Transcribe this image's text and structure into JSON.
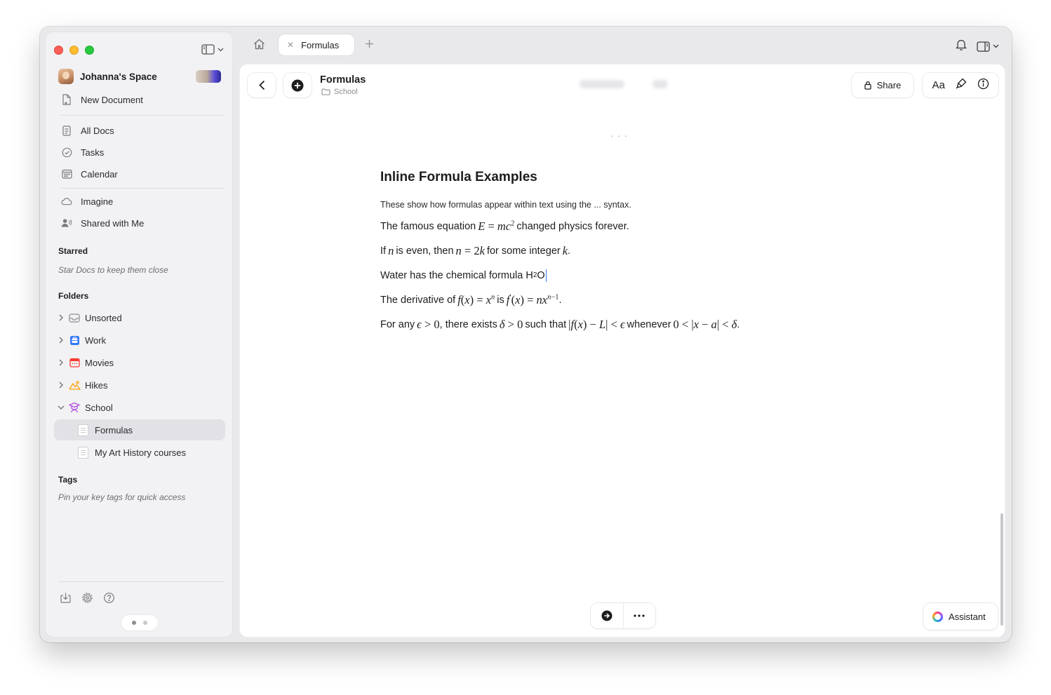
{
  "sidebar": {
    "space_name": "Johanna's Space",
    "new_document": "New Document",
    "nav": [
      {
        "label": "All Docs",
        "icon": "document-icon"
      },
      {
        "label": "Tasks",
        "icon": "checkmark-circle-icon"
      },
      {
        "label": "Calendar",
        "icon": "calendar-icon"
      },
      {
        "label": "Imagine",
        "icon": "cloud-icon"
      },
      {
        "label": "Shared with Me",
        "icon": "shared-person-icon"
      }
    ],
    "starred_title": "Starred",
    "starred_hint": "Star Docs to keep them close",
    "folders_title": "Folders",
    "folders": [
      {
        "label": "Unsorted",
        "icon": "inbox-icon",
        "color": "#8e8e93"
      },
      {
        "label": "Work",
        "icon": "briefcase-icon",
        "color": "#3478f6"
      },
      {
        "label": "Movies",
        "icon": "calendar-icon",
        "color": "#ff3b30"
      },
      {
        "label": "Hikes",
        "icon": "mountain-icon",
        "color": "#ff9f0a"
      },
      {
        "label": "School",
        "icon": "graduation-icon",
        "color": "#af52de"
      }
    ],
    "school_docs": [
      "Formulas",
      "My Art History courses"
    ],
    "tags_title": "Tags",
    "tags_hint": "Pin your key tags for quick access"
  },
  "tabs": {
    "active_label": "Formulas"
  },
  "document": {
    "title": "Formulas",
    "folder": "School",
    "share_label": "Share",
    "font_label": "Aa",
    "heading": "Inline Formula Examples",
    "intro": "These show how formulas appear within text using the ... syntax.",
    "line1": {
      "before": "The famous equation",
      "after": "changed physics forever."
    },
    "line2": {
      "a": "If",
      "b": "is even, then",
      "c": "for some integer",
      "d": "."
    },
    "line3": {
      "text": "Water has the chemical formula H",
      "sub": "2",
      "end": "O"
    },
    "line4": {
      "a": "The derivative of",
      "b": "is",
      "c": "."
    },
    "line5": {
      "a": "For any",
      "b": ", there exists",
      "c": "such that",
      "d": "whenever",
      "e": "."
    }
  },
  "footer": {
    "assistant_label": "Assistant"
  },
  "colors": {
    "accent": "#3478f6",
    "sidebar_bg": "#f2f2f4",
    "window_bg": "#e9e9eb"
  }
}
